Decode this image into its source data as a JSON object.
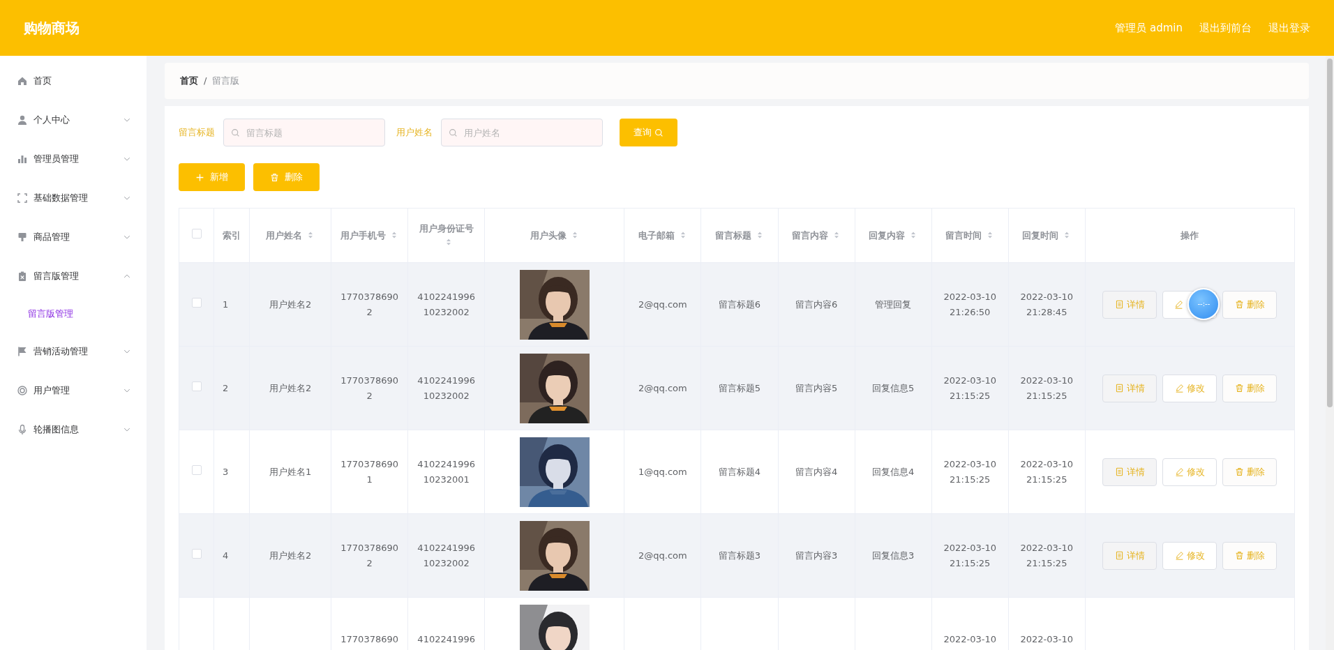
{
  "header": {
    "title": "购物商场",
    "links": [
      "管理员 admin",
      "退出到前台",
      "退出登录"
    ]
  },
  "sidebar": {
    "items": [
      {
        "label": "首页",
        "kind": "link"
      },
      {
        "label": "个人中心",
        "kind": "group",
        "expanded": false
      },
      {
        "label": "管理员管理",
        "kind": "group",
        "expanded": false
      },
      {
        "label": "基础数据管理",
        "kind": "group",
        "expanded": false
      },
      {
        "label": "商品管理",
        "kind": "group",
        "expanded": false
      },
      {
        "label": "留言版管理",
        "kind": "group",
        "expanded": true,
        "children": [
          {
            "label": "留言版管理",
            "selected": true
          }
        ]
      },
      {
        "label": "营销活动管理",
        "kind": "group",
        "expanded": false
      },
      {
        "label": "用户管理",
        "kind": "group",
        "expanded": false
      },
      {
        "label": "轮播图信息",
        "kind": "group",
        "expanded": false
      }
    ]
  },
  "breadcrumb": {
    "items": [
      "首页",
      "留言版"
    ],
    "separator": "/"
  },
  "search": {
    "fields": [
      {
        "label": "留言标题",
        "placeholder": "留言标题"
      },
      {
        "label": "用户姓名",
        "placeholder": "用户姓名"
      }
    ],
    "button": "查询"
  },
  "toolbar": [
    {
      "label": "新增",
      "kind": "add"
    },
    {
      "label": "删除",
      "kind": "delete"
    }
  ],
  "table": {
    "columns": [
      {
        "kind": "checkbox",
        "checked": false
      },
      {
        "label": "索引",
        "sortable": false
      },
      {
        "label": "用户姓名",
        "sortable": true
      },
      {
        "label": "用户手机号",
        "sortable": true
      },
      {
        "label": "用户身份证号",
        "sortable": true
      },
      {
        "label": "用户头像",
        "sortable": true
      },
      {
        "label": "电子邮箱",
        "sortable": true
      },
      {
        "label": "留言标题",
        "sortable": true
      },
      {
        "label": "留言内容",
        "sortable": true
      },
      {
        "label": "回复内容",
        "sortable": true
      },
      {
        "label": "留言时间",
        "sortable": true
      },
      {
        "label": "回复时间",
        "sortable": true
      },
      {
        "label": "操作",
        "sortable": false
      }
    ],
    "rows": [
      {
        "checked": false,
        "highlighted": true,
        "index": "1",
        "name": "用户姓名2",
        "phone": "17703786902",
        "id_number": "410224199610232002",
        "email": "2@qq.com",
        "title": "留言标题6",
        "content": "留言内容6",
        "reply": "管理回复",
        "message_time": "2022-03-10 21:26:50",
        "reply_time": "2022-03-10 21:28:45",
        "actions": [
          {
            "kind": "detail",
            "label": "详情"
          },
          {
            "kind": "edit"
          },
          {
            "kind": "delete",
            "label": "删除"
          }
        ],
        "floating_widget": {
          "text": "--:--"
        }
      },
      {
        "checked": false,
        "highlighted": true,
        "index": "2",
        "name": "用户姓名2",
        "phone": "17703786902",
        "id_number": "410224199610232002",
        "email": "2@qq.com",
        "title": "留言标题5",
        "content": "留言内容5",
        "reply": "回复信息5",
        "message_time": "2022-03-10 21:15:25",
        "reply_time": "2022-03-10 21:15:25",
        "actions": [
          {
            "kind": "detail",
            "label": "详情"
          },
          {
            "kind": "edit",
            "label": "修改"
          },
          {
            "kind": "delete",
            "label": "删除"
          }
        ]
      },
      {
        "checked": false,
        "highlighted": false,
        "index": "3",
        "name": "用户姓名1",
        "phone": "17703786901",
        "id_number": "410224199610232001",
        "email": "1@qq.com",
        "title": "留言标题4",
        "content": "留言内容4",
        "reply": "回复信息4",
        "message_time": "2022-03-10 21:15:25",
        "reply_time": "2022-03-10 21:15:25",
        "actions": [
          {
            "kind": "detail",
            "label": "详情"
          },
          {
            "kind": "edit",
            "label": "修改"
          },
          {
            "kind": "delete",
            "label": "删除"
          }
        ]
      },
      {
        "checked": false,
        "highlighted": true,
        "index": "4",
        "name": "用户姓名2",
        "phone": "17703786902",
        "id_number": "410224199610232002",
        "email": "2@qq.com",
        "title": "留言标题3",
        "content": "留言内容3",
        "reply": "回复信息3",
        "message_time": "2022-03-10 21:15:25",
        "reply_time": "2022-03-10 21:15:25",
        "actions": [
          {
            "kind": "detail",
            "label": "详情"
          },
          {
            "kind": "edit",
            "label": "修改"
          },
          {
            "kind": "delete",
            "label": "删除"
          }
        ]
      },
      {
        "highlighted": false,
        "phone": "1770378690",
        "id_number": "4102241996",
        "message_time": "2022-03-10",
        "reply_time": "2022-03-10"
      }
    ]
  }
}
